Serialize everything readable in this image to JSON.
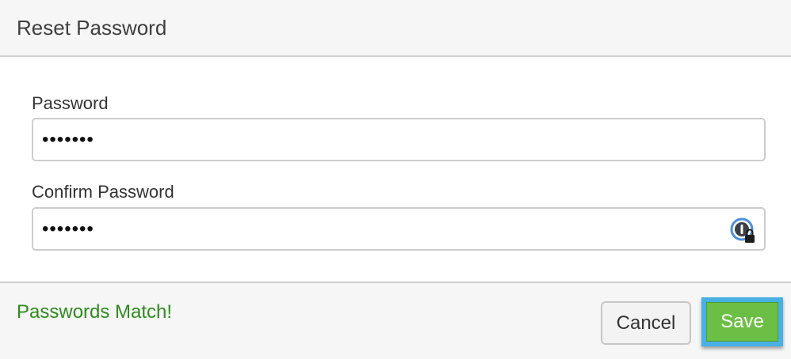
{
  "dialog": {
    "title": "Reset Password"
  },
  "form": {
    "password": {
      "label": "Password",
      "value": "•••••••"
    },
    "confirm_password": {
      "label": "Confirm Password",
      "value": "•••••••",
      "trailing_icon": "password-manager-icon"
    }
  },
  "footer": {
    "status": "Passwords Match!",
    "cancel_label": "Cancel",
    "save_label": "Save"
  },
  "colors": {
    "status_text": "#2f8a1e",
    "save_background": "#6cbf45",
    "focus_outline": "#47b1e6"
  }
}
